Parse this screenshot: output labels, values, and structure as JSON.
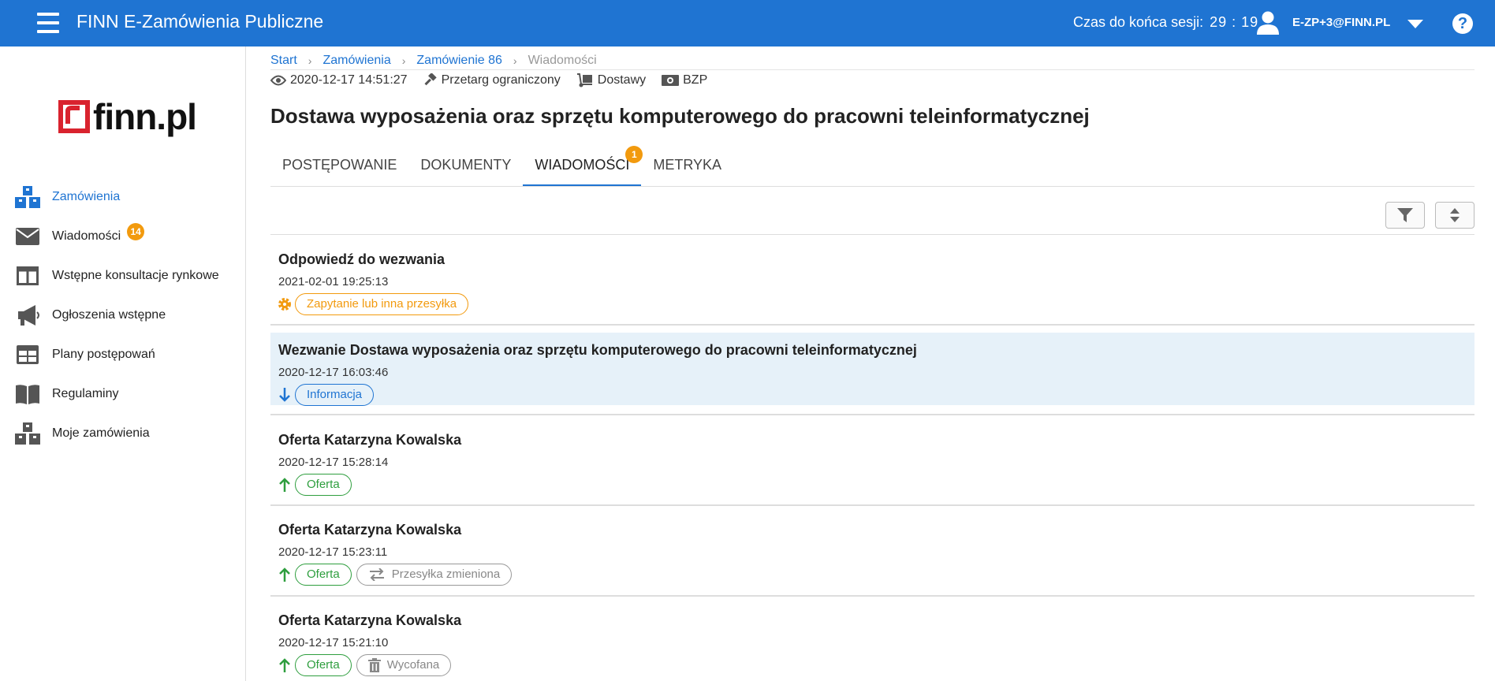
{
  "header": {
    "app_title": "FINN E-Zamówienia Publiczne",
    "session_label": "Czas do końca sesji:",
    "session_time": "29 : 19",
    "user": "E-ZP+3@FINN.PL"
  },
  "logo": {
    "text": "finn.pl"
  },
  "sidebar": {
    "items": [
      {
        "label": "Zamówienia",
        "icon": "boxes-icon",
        "active": true
      },
      {
        "label": "Wiadomości",
        "icon": "envelope-icon",
        "badge": "14"
      },
      {
        "label": "Wstępne konsultacje rynkowe",
        "icon": "columns-icon"
      },
      {
        "label": "Ogłoszenia wstępne",
        "icon": "megaphone-icon"
      },
      {
        "label": "Plany postępowań",
        "icon": "table-icon"
      },
      {
        "label": "Regulaminy",
        "icon": "book-icon"
      },
      {
        "label": "Moje zamówienia",
        "icon": "boxes-icon"
      }
    ]
  },
  "breadcrumb": {
    "items": [
      "Start",
      "Zamówienia",
      "Zamówienie 86"
    ],
    "current": "Wiadomości"
  },
  "meta": {
    "datetime": "2020-12-17 14:51:27",
    "procedure": "Przetarg ograniczony",
    "type": "Dostawy",
    "registry": "BZP"
  },
  "page_title": "Dostawa wyposażenia oraz sprzętu komputerowego do pracowni teleinformatycznej",
  "tabs": [
    {
      "label": "POSTĘPOWANIE"
    },
    {
      "label": "DOKUMENTY"
    },
    {
      "label": "WIADOMOŚCI",
      "active": true,
      "badge": "1"
    },
    {
      "label": "METRYKA"
    }
  ],
  "messages": [
    {
      "title": "Odpowiedź do wezwania",
      "date": "2021-02-01 19:25:13",
      "direction": "gear-icon",
      "tags": [
        {
          "label": "Zapytanie lub inna przesyłka",
          "color": "#f29a0e"
        }
      ]
    },
    {
      "title": "Wezwanie Dostawa wyposażenia oraz sprzętu komputerowego do pracowni teleinformatycznej",
      "date": "2020-12-17 16:03:46",
      "direction": "arrow-down-icon",
      "highlight": true,
      "tags": [
        {
          "label": "Informacja",
          "color": "#1f74d2"
        }
      ]
    },
    {
      "title": "Oferta Katarzyna Kowalska",
      "date": "2020-12-17 15:28:14",
      "direction": "arrow-up-icon",
      "tags": [
        {
          "label": "Oferta",
          "color": "#2e9e3e"
        }
      ]
    },
    {
      "title": "Oferta Katarzyna Kowalska",
      "date": "2020-12-17 15:23:11",
      "direction": "arrow-up-icon",
      "tags": [
        {
          "label": "Oferta",
          "color": "#2e9e3e"
        },
        {
          "label": "Przesyłka zmieniona",
          "icon": "exchange-icon"
        }
      ]
    },
    {
      "title": "Oferta Katarzyna Kowalska",
      "date": "2020-12-17 15:21:10",
      "direction": "arrow-up-icon",
      "tags": [
        {
          "label": "Oferta",
          "color": "#2e9e3e"
        },
        {
          "label": "Wycofana",
          "icon": "trash-icon"
        }
      ]
    }
  ]
}
